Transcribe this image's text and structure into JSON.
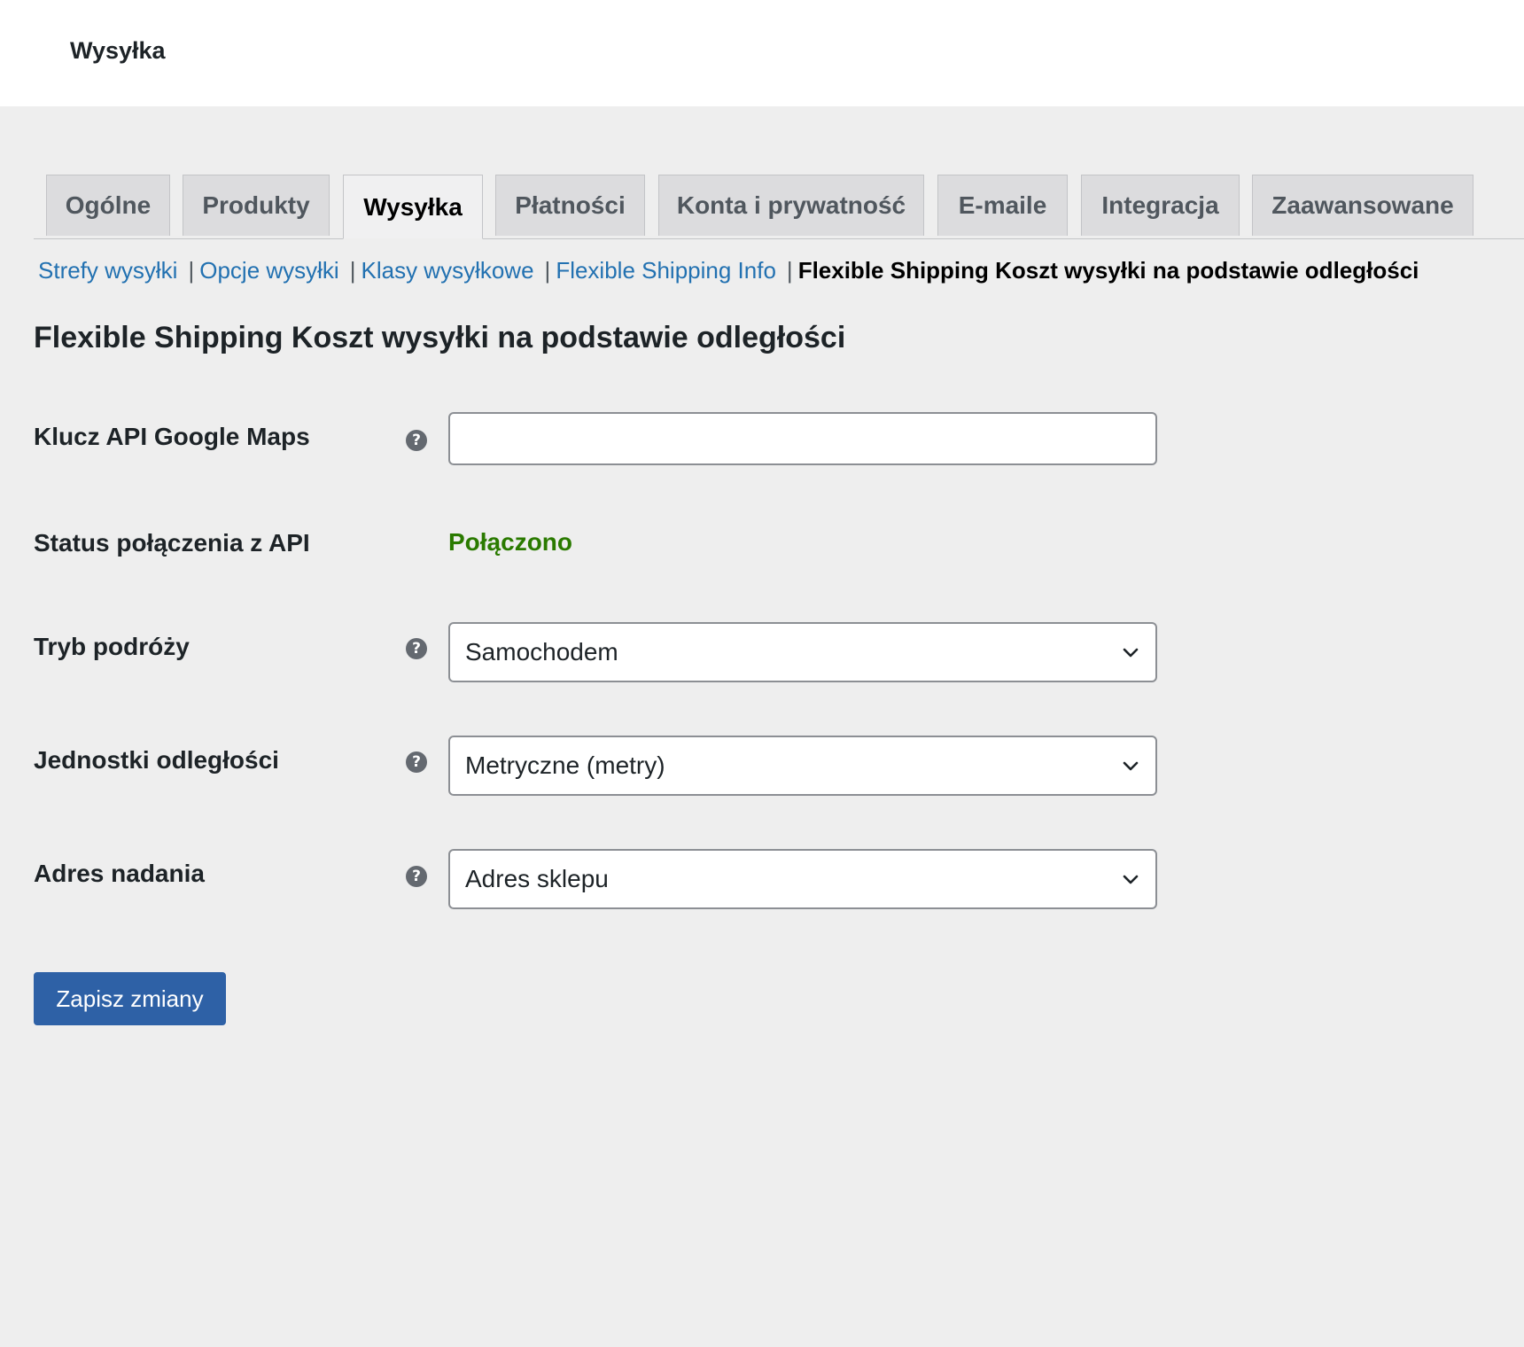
{
  "page": {
    "title": "Wysyłka"
  },
  "tabs": [
    {
      "label": "Ogólne"
    },
    {
      "label": "Produkty"
    },
    {
      "label": "Wysyłka",
      "active": true
    },
    {
      "label": "Płatności"
    },
    {
      "label": "Konta i prywatność"
    },
    {
      "label": "E-maile"
    },
    {
      "label": "Integracja"
    },
    {
      "label": "Zaawansowane"
    }
  ],
  "subnav": {
    "links": [
      "Strefy wysyłki",
      "Opcje wysyłki",
      "Klasy wysyłkowe",
      "Flexible Shipping Info"
    ],
    "separator": "|",
    "current": "Flexible Shipping Koszt wysyłki na podstawie odległości"
  },
  "section": {
    "heading": "Flexible Shipping Koszt wysyłki na podstawie odległości"
  },
  "fields": {
    "api_key": {
      "label": "Klucz API Google Maps",
      "value": ""
    },
    "api_status": {
      "label": "Status połączenia z API",
      "value": "Połączono"
    },
    "travel_mode": {
      "label": "Tryb podróży",
      "value": "Samochodem"
    },
    "distance_units": {
      "label": "Jednostki odległości",
      "value": "Metryczne (metry)"
    },
    "origin_address": {
      "label": "Adres nadania",
      "value": "Adres sklepu"
    }
  },
  "help_icon_glyph": "?",
  "save_button": {
    "label": "Zapisz zmiany"
  },
  "colors": {
    "link": "#2271b1",
    "status_ok": "#2a7a00",
    "primary_button": "#2e61a6",
    "background": "#eeeeee"
  }
}
